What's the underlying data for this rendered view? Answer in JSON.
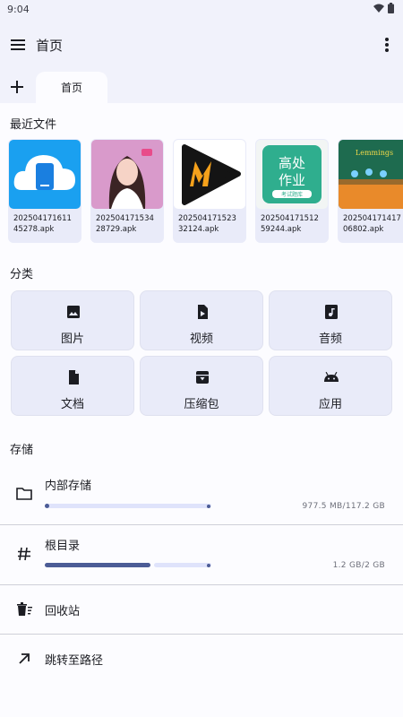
{
  "status_bar": {
    "time": "9:04",
    "icons": [
      "wifi-icon",
      "battery-icon"
    ]
  },
  "app_bar": {
    "title": "首页",
    "menu_icon": "hamburger-menu-icon",
    "more_icon": "more-vert-icon"
  },
  "tabs": {
    "add_icon": "plus-icon",
    "items": [
      {
        "label": "首页"
      }
    ]
  },
  "recent": {
    "title": "最近文件",
    "files": [
      {
        "name": "20250417161145278.apk",
        "icon": "cloud-phone-app-icon"
      },
      {
        "name": "20250417153428729.apk",
        "icon": "anime-girl-app-icon"
      },
      {
        "name": "20250417152332124.apk",
        "icon": "m-play-app-icon"
      },
      {
        "name": "20250417151259244.apk",
        "icon": "gaokao-zuoye-app-icon"
      },
      {
        "name": "20250417141706802.apk",
        "icon": "lemmings-game-icon"
      }
    ]
  },
  "categories": {
    "title": "分类",
    "items": [
      {
        "label": "图片",
        "icon": "image-icon"
      },
      {
        "label": "视频",
        "icon": "video-file-icon"
      },
      {
        "label": "音频",
        "icon": "audio-file-icon"
      },
      {
        "label": "文档",
        "icon": "document-icon"
      },
      {
        "label": "压缩包",
        "icon": "archive-icon"
      },
      {
        "label": "应用",
        "icon": "android-icon"
      }
    ]
  },
  "storage": {
    "title": "存储",
    "items": [
      {
        "label": "内部存储",
        "value": "977.5 MB/117.2 GB",
        "used_fraction": 0.0083,
        "icon": "folder-icon"
      },
      {
        "label": "根目录",
        "value": "1.2 GB/2 GB",
        "used_fraction": 0.6,
        "icon": "hash-icon"
      }
    ]
  },
  "actions": [
    {
      "label": "回收站",
      "icon": "recycle-bin-icon"
    },
    {
      "label": "跳转至路径",
      "icon": "arrow-up-right-icon"
    }
  ],
  "colors": {
    "accent": "#4c5c96",
    "track": "#dfe3fb",
    "card": "#e9ebf9",
    "surface": "#fcfcff",
    "chrome": "#f1f2fb"
  }
}
